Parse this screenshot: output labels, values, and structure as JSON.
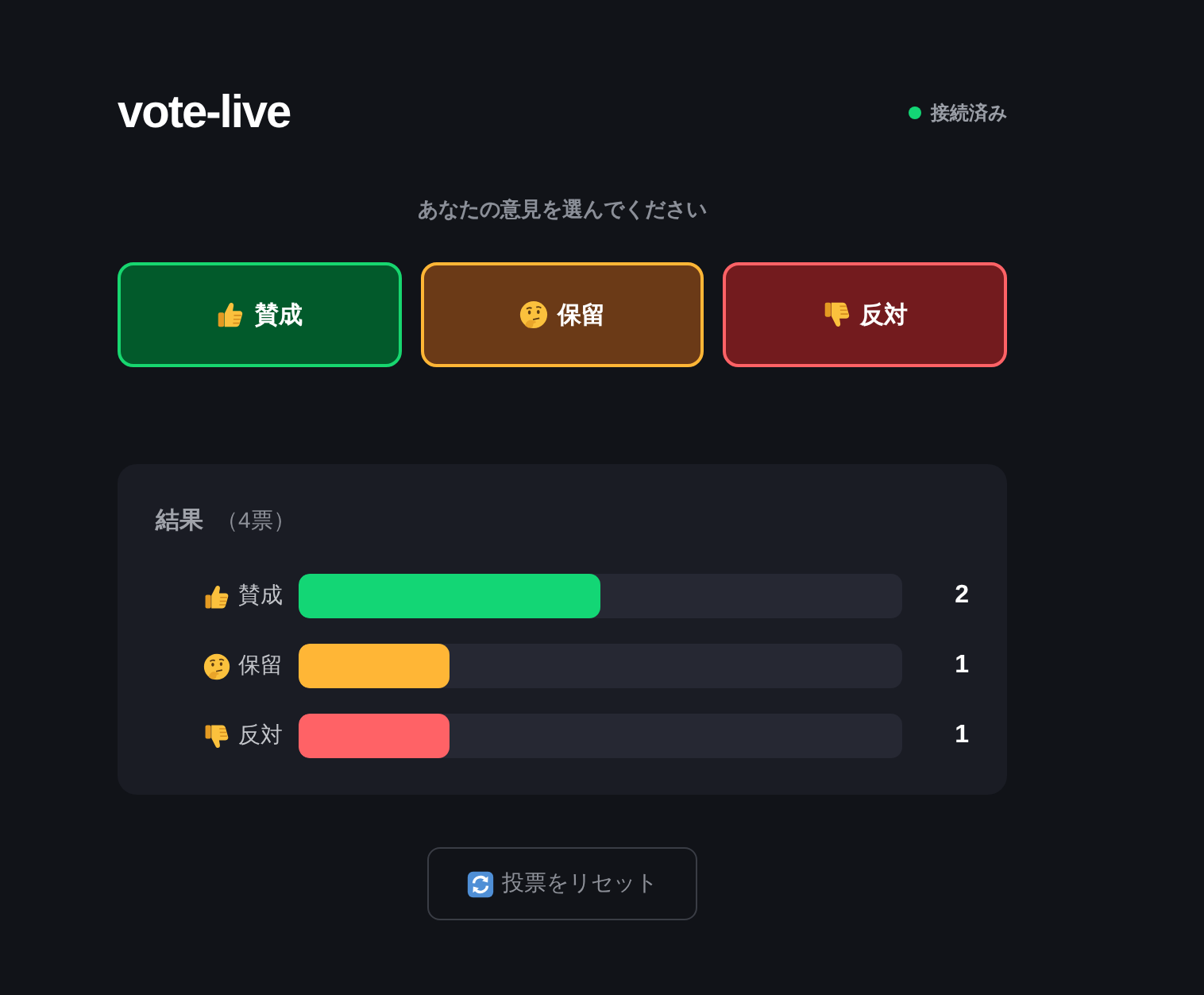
{
  "header": {
    "title": "vote-live",
    "status": {
      "label": "接続済み",
      "connected": true
    }
  },
  "prompt": "あなたの意見を選んでください",
  "options": [
    {
      "kind": "up",
      "label": "賛成",
      "color": "#17d66f"
    },
    {
      "kind": "think",
      "label": "保留",
      "color": "#ffb636"
    },
    {
      "kind": "down",
      "label": "反対",
      "color": "#ff6266"
    }
  ],
  "results": {
    "title": "結果",
    "total": "（4票）",
    "rows": [
      {
        "kind": "up",
        "label": "賛成",
        "level": 0.5,
        "count": "2",
        "color": "#13d675"
      },
      {
        "kind": "think",
        "label": "保留",
        "level": 0.25,
        "count": "1",
        "color": "#ffb636"
      },
      {
        "kind": "down",
        "label": "反対",
        "level": 0.25,
        "count": "1",
        "color": "#ff6266"
      }
    ]
  },
  "reset_button": {
    "label": "投票をリセット"
  }
}
